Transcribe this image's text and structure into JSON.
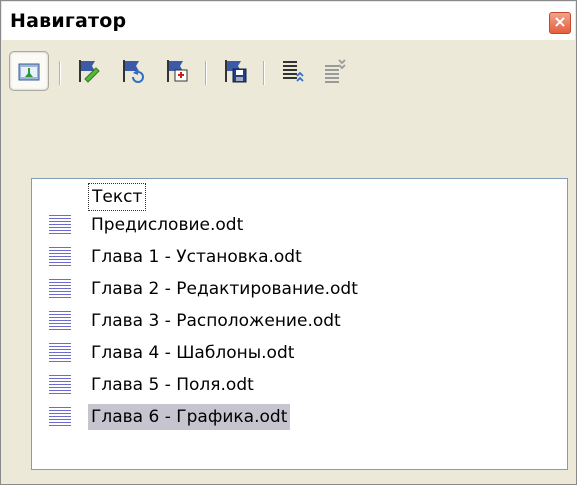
{
  "window": {
    "title": "Навигатор"
  },
  "toolbar": {
    "buttons": [
      {
        "icon": "toggle-icon",
        "pressed": true
      },
      {
        "icon": "edit-icon"
      },
      {
        "icon": "update-icon"
      },
      {
        "icon": "insert-icon"
      },
      {
        "icon": "save-as-icon"
      },
      {
        "icon": "promote-icon"
      },
      {
        "icon": "demote-icon"
      }
    ]
  },
  "list": {
    "items": [
      {
        "label": "Текст"
      },
      {
        "label": "Предисловие.odt"
      },
      {
        "label": "Глава 1 - Установка.odt"
      },
      {
        "label": "Глава 2 - Редактирование.odt"
      },
      {
        "label": "Глава 3 - Расположение.odt"
      },
      {
        "label": "Глава 4 - Шаблоны.odt"
      },
      {
        "label": "Глава 5 - Поля.odt"
      },
      {
        "label": "Глава 6 - Графика.odt"
      }
    ],
    "selected_index": 7
  },
  "colors": {
    "selection": "#c6c4cf",
    "level_lines": "#6b6bd6",
    "panel_bg": "#ece9d8"
  }
}
